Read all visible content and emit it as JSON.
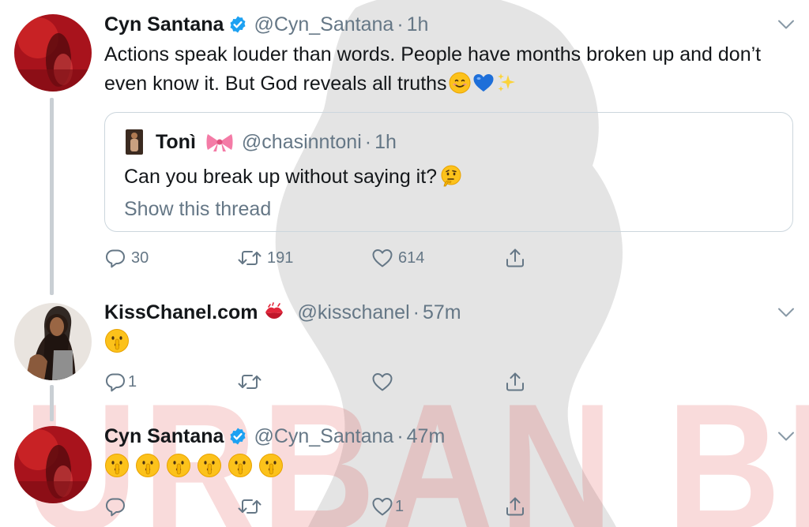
{
  "watermark": {
    "text": "URBAN BELLE"
  },
  "tweets": [
    {
      "display_name": "Cyn Santana",
      "verified": true,
      "handle": "@Cyn_Santana",
      "separator": "·",
      "time": "1h",
      "text": "Actions speak louder than words. People have months broken up and don’t even know it. But God reveals all truths",
      "emojis": [
        "smiling-face-emoji",
        "blue-heart-emoji",
        "sparkles-emoji"
      ],
      "quote": {
        "display_name": "Tonì",
        "handle": "@chasinntoni",
        "separator": "·",
        "time": "1h",
        "name_emoji": "ribbon-emoji",
        "text": "Can you break up without saying it?",
        "text_emoji": "thinking-face-emoji",
        "link": "Show this thread"
      },
      "actions": {
        "replies": "30",
        "retweets": "191",
        "likes": "614"
      }
    },
    {
      "display_name": "KissChanel.com",
      "name_emoji": "kiss-mark-emoji",
      "handle": "@kisschanel",
      "separator": "·",
      "time": "57m",
      "emojis": [
        "shushing-face-emoji"
      ],
      "actions": {
        "replies": "1",
        "retweets": "",
        "likes": ""
      }
    },
    {
      "display_name": "Cyn Santana",
      "verified": true,
      "handle": "@Cyn_Santana",
      "separator": "·",
      "time": "47m",
      "emojis": [
        "shushing-face-emoji",
        "shushing-face-emoji",
        "shushing-face-emoji",
        "shushing-face-emoji",
        "shushing-face-emoji",
        "shushing-face-emoji"
      ],
      "actions": {
        "replies": "",
        "retweets": "",
        "likes": "1"
      }
    }
  ],
  "colors": {
    "verified": "#1da1f2",
    "secondary_text": "#657786",
    "thread_line": "#c9cfd4",
    "watermark": "#dc2828"
  }
}
